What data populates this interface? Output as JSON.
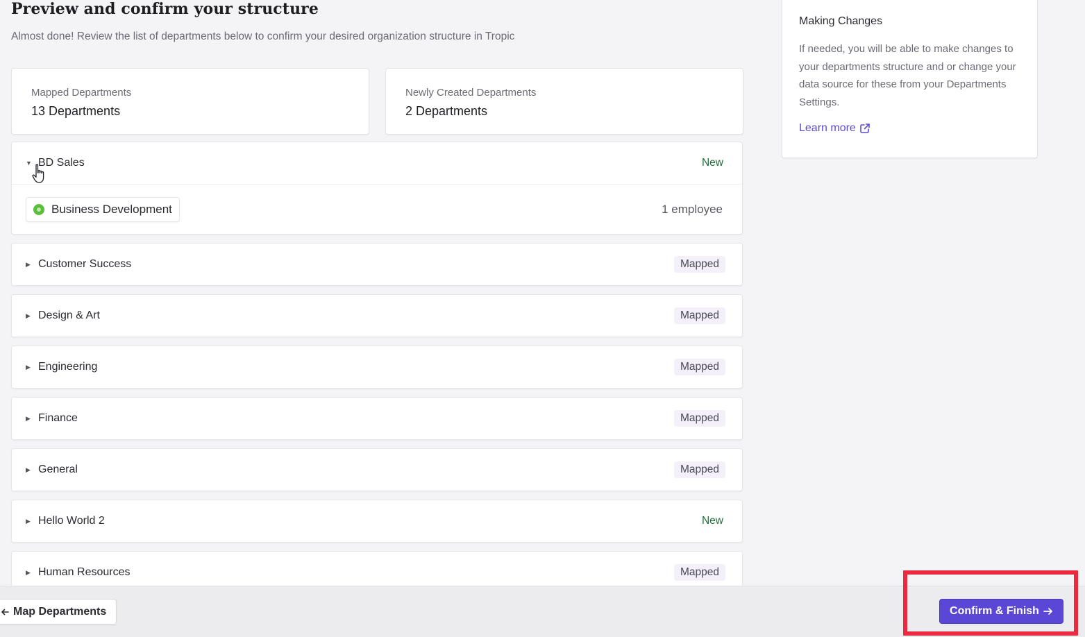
{
  "page": {
    "title": "Preview and confirm your structure",
    "subtitle": "Almost done! Review the list of departments below to confirm your desired organization structure in Tropic"
  },
  "stats": {
    "mapped": {
      "label": "Mapped Departments",
      "value": "13 Departments"
    },
    "created": {
      "label": "Newly Created Departments",
      "value": "2 Departments"
    }
  },
  "departments": [
    {
      "name": "BD Sales",
      "status": "New",
      "status_type": "new",
      "expanded": true,
      "children": [
        {
          "name": "Business Development",
          "count": "1 employee"
        }
      ]
    },
    {
      "name": "Customer Success",
      "status": "Mapped",
      "status_type": "mapped",
      "expanded": false
    },
    {
      "name": "Design & Art",
      "status": "Mapped",
      "status_type": "mapped",
      "expanded": false
    },
    {
      "name": "Engineering",
      "status": "Mapped",
      "status_type": "mapped",
      "expanded": false
    },
    {
      "name": "Finance",
      "status": "Mapped",
      "status_type": "mapped",
      "expanded": false
    },
    {
      "name": "General",
      "status": "Mapped",
      "status_type": "mapped",
      "expanded": false
    },
    {
      "name": "Hello World 2",
      "status": "New",
      "status_type": "new",
      "expanded": false
    },
    {
      "name": "Human Resources",
      "status": "Mapped",
      "status_type": "mapped",
      "expanded": false
    }
  ],
  "sidebar": {
    "heading": "Making Changes",
    "body": "If needed, you will be able to make changes to your departments structure and or change your data source for these from your Departments Settings.",
    "link_label": "Learn more"
  },
  "footer": {
    "back_label": "Map Departments",
    "confirm_label": "Confirm & Finish"
  },
  "colors": {
    "accent": "#5b47d6",
    "link": "#5b4bd5",
    "new_badge": "#1f6b3a",
    "highlight": "#ea2a3f",
    "dept_dot": "#5bbd3c"
  },
  "icons": {
    "caret_expanded": "caret-down-icon",
    "caret_collapsed": "caret-right-icon",
    "external_link": "external-link-icon",
    "back_arrow": "arrow-left-icon",
    "forward_arrow": "arrow-right-icon",
    "cursor": "hand-pointer-icon"
  }
}
